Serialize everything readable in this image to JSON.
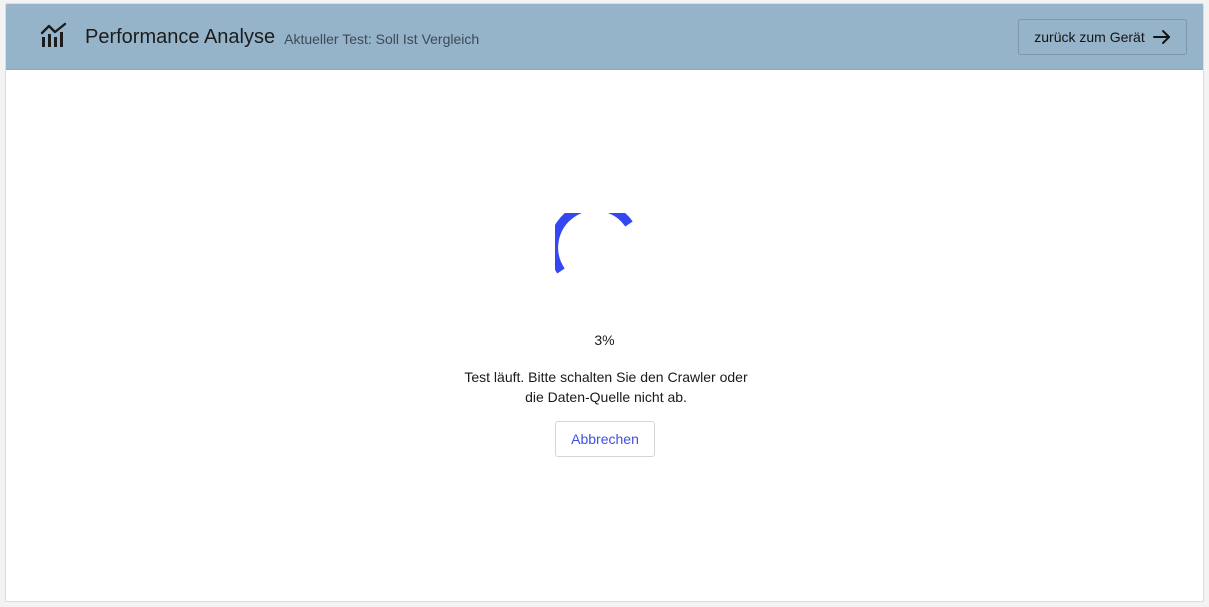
{
  "header": {
    "icon": "bar-chart-trend-icon",
    "title": "Performance Analyse",
    "subtitle": "Aktueller Test: Soll Ist Vergleich",
    "back_button_label": "zurück zum Gerät",
    "back_button_icon": "arrow-right-icon"
  },
  "progress": {
    "percent_label": "3%",
    "percent": 3,
    "status_line1": "Test läuft. Bitte schalten Sie den Crawler oder",
    "status_line2": "die Daten-Quelle nicht ab.",
    "cancel_label": "Abbrechen",
    "spinner_color": "#3547f0"
  },
  "colors": {
    "header_background": "#95b3c9",
    "accent": "#3f51e0"
  }
}
